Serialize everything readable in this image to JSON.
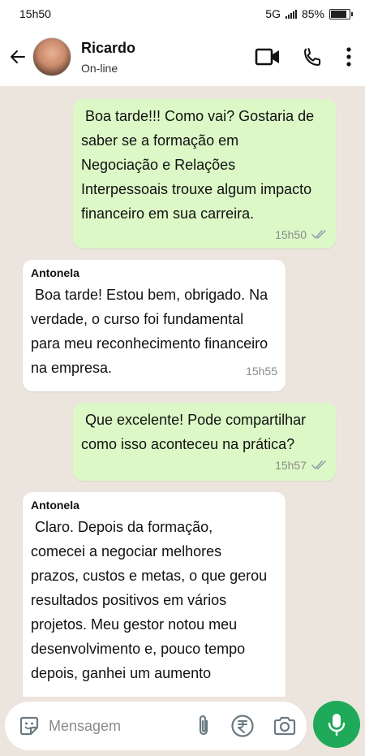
{
  "status_bar": {
    "time": "15h50",
    "network": "5G",
    "battery": "85%",
    "battery_level": 0.85
  },
  "header": {
    "back_icon": "arrow-left-icon",
    "contact_name": "Ricardo",
    "contact_status": "On-line",
    "actions": [
      "video-call-icon",
      "phone-icon",
      "more-vertical-icon"
    ]
  },
  "messages": [
    {
      "direction": "out",
      "sender": "",
      "lines": [
        " Boa tarde!!! Como vai? Gostaria de",
        "saber se a formação em",
        "Negociação e Relações",
        "Interpessoais trouxe algum impacto",
        "financeiro em sua carreira."
      ],
      "time": "15h50",
      "read": true
    },
    {
      "direction": "in",
      "sender": "Antonela",
      "lines": [
        " Boa tarde! Estou bem, obrigado. Na",
        "verdade, o curso foi fundamental",
        "para meu reconhecimento financeiro",
        "na empresa."
      ],
      "time": "15h55"
    },
    {
      "direction": "out",
      "sender": "",
      "lines": [
        " Que excelente! Pode compartilhar",
        "como isso aconteceu na prática?"
      ],
      "time": "15h57",
      "read": true
    },
    {
      "direction": "in",
      "sender": "Antonela",
      "lines": [
        " Claro. Depois da formação,",
        "comecei a negociar melhores",
        "prazos, custos e metas, o que gerou",
        "resultados positivos em vários",
        "projetos. Meu gestor notou meu",
        "desenvolvimento e, pouco tempo",
        "depois, ganhei um aumento"
      ],
      "time": ""
    }
  ],
  "composer": {
    "placeholder": "Mensagem",
    "icons": [
      "sticker-icon",
      "paperclip-icon",
      "rupee-icon",
      "camera-icon"
    ],
    "mic_icon": "microphone-icon"
  },
  "colors": {
    "outgoing": "#dcf8c6",
    "incoming": "#ffffff",
    "accent": "#1faa59",
    "background": "#ece5dd"
  }
}
